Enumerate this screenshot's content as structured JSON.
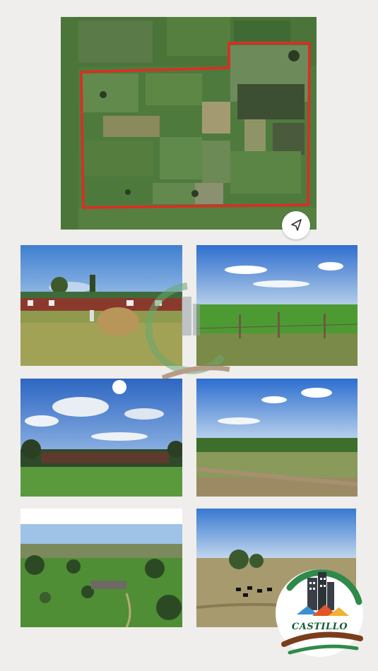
{
  "map": {
    "outline_color": "#e22a22",
    "navigate_icon": "navigation-arrow-icon"
  },
  "photos": [
    {
      "subject": "farmhouse-garden"
    },
    {
      "subject": "green-crop-field"
    },
    {
      "subject": "farmhouse-trees-sun"
    },
    {
      "subject": "field-edge-dirt-track"
    },
    {
      "subject": "aerial-farmstead"
    },
    {
      "subject": "cattle-pasture"
    }
  ],
  "logo": {
    "name": "CASTILLO",
    "name_color": "#0f5d34",
    "accent": "#7a3d1c",
    "green": "#2f8a4a"
  },
  "watermark": {
    "visible": true
  }
}
